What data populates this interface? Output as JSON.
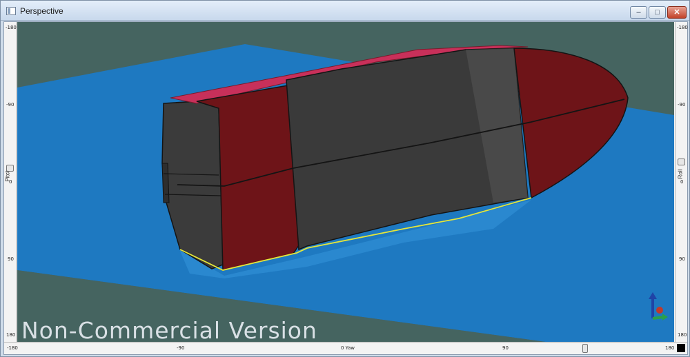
{
  "window": {
    "title": "Perspective",
    "minimize_glyph": "–",
    "maximize_glyph": "□",
    "close_glyph": "✕"
  },
  "rulers": {
    "left": {
      "label": "Pitch",
      "ticks": [
        "-180",
        "-90",
        "0",
        "90",
        "180"
      ]
    },
    "right": {
      "label": "Roll",
      "ticks": [
        "-180",
        "-90",
        "0",
        "90",
        "180"
      ]
    },
    "bottom": {
      "ticks": [
        "-180",
        "-90",
        "0 Yaw",
        "90",
        "180"
      ]
    }
  },
  "viewport": {
    "watermark": "Non-Commercial Version",
    "background_color": "#456460",
    "water_color": "#1e79c1",
    "hull_colors": {
      "topsides": "#6e1418",
      "body": "#3a3a3a",
      "deck_edge": "#c8305a",
      "waterline": "#e4e63a"
    }
  },
  "icons": {
    "window_icon": "window-icon",
    "axis_gizmo": "xyz-axis-gizmo-icon"
  }
}
